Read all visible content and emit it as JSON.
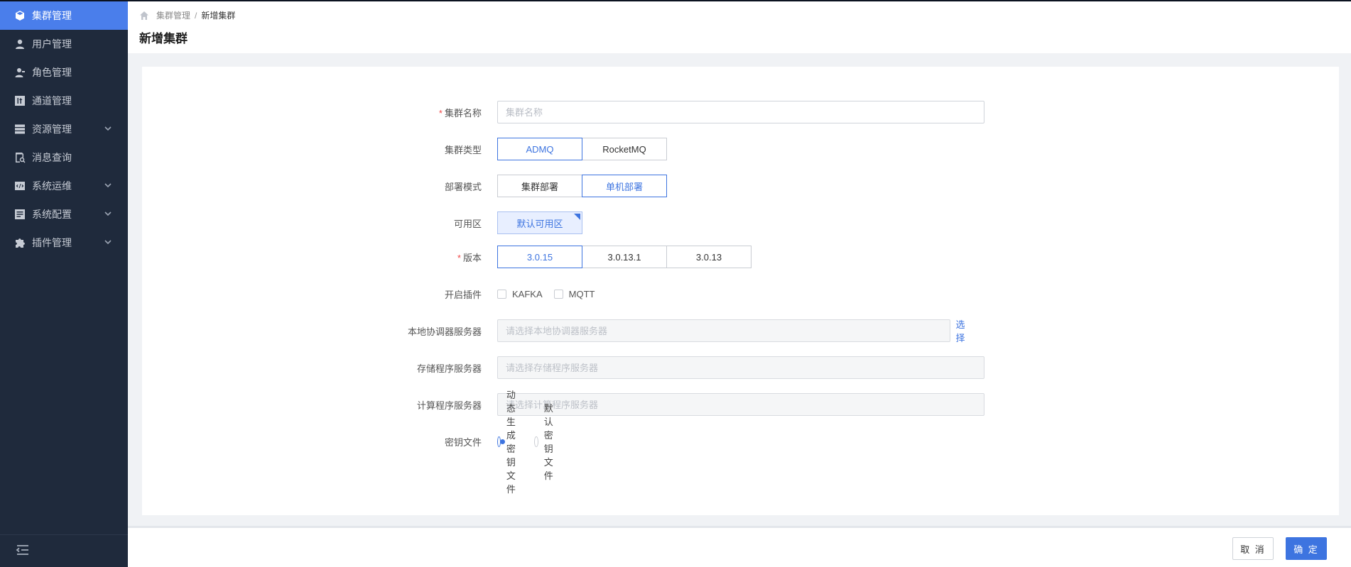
{
  "sidebar": {
    "items": [
      {
        "label": "集群管理",
        "icon": "cube-icon",
        "active": true
      },
      {
        "label": "用户管理",
        "icon": "user-icon"
      },
      {
        "label": "角色管理",
        "icon": "role-icon"
      },
      {
        "label": "通道管理",
        "icon": "channel-icon"
      },
      {
        "label": "资源管理",
        "icon": "server-icon",
        "expandable": true
      },
      {
        "label": "消息查询",
        "icon": "doc-search-icon"
      },
      {
        "label": "系统运维",
        "icon": "code-icon",
        "expandable": true
      },
      {
        "label": "系统配置",
        "icon": "config-icon",
        "expandable": true
      },
      {
        "label": "插件管理",
        "icon": "puzzle-icon",
        "expandable": true
      }
    ],
    "collapse_icon": "menu-fold-icon"
  },
  "header": {
    "breadcrumb": {
      "parent": "集群管理",
      "separator": "/",
      "current": "新增集群"
    },
    "title": "新增集群"
  },
  "form": {
    "name": {
      "label": "集群名称",
      "placeholder": "集群名称",
      "value": "",
      "required": true
    },
    "type": {
      "label": "集群类型",
      "options": [
        "ADMQ",
        "RocketMQ"
      ],
      "selected": "ADMQ"
    },
    "deploy": {
      "label": "部署模式",
      "options": [
        "集群部署",
        "单机部署"
      ],
      "selected": "单机部署"
    },
    "zone": {
      "label": "可用区",
      "options": [
        "默认可用区"
      ],
      "selected": "默认可用区"
    },
    "version": {
      "label": "版本",
      "required": true,
      "options": [
        "3.0.15",
        "3.0.13.1",
        "3.0.13"
      ],
      "selected": "3.0.15"
    },
    "plugins": {
      "label": "开启插件",
      "options": [
        "KAFKA",
        "MQTT"
      ]
    },
    "coordinator": {
      "label": "本地协调器服务器",
      "placeholder": "请选择本地协调器服务器",
      "select_label": "选择"
    },
    "storage": {
      "label": "存储程序服务器",
      "placeholder": "请选择存储程序服务器"
    },
    "compute": {
      "label": "计算程序服务器",
      "placeholder": "请选择计算程序服务器"
    },
    "keyfile": {
      "label": "密钥文件",
      "options": [
        "动态生成密钥文件",
        "默认密钥文件"
      ],
      "selected": "动态生成密钥文件"
    }
  },
  "footer": {
    "cancel_label": "取 消",
    "ok_label": "确 定"
  },
  "colors": {
    "accent": "#3d74e0",
    "sidebar_bg": "#1f2a3c",
    "sidebar_active": "#4a7eeb",
    "required": "#f04848"
  }
}
